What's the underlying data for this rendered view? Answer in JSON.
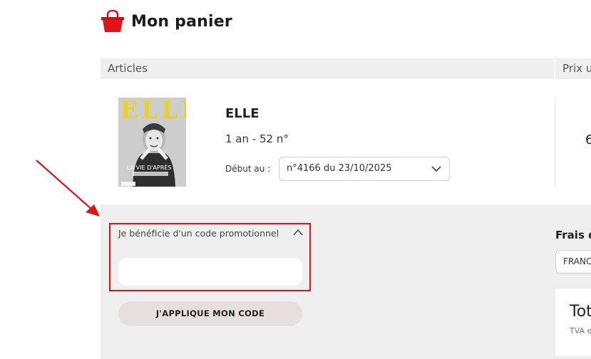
{
  "header": {
    "title": "Mon panier",
    "icon": "shopping-bag-icon"
  },
  "table": {
    "col_articles": "Articles",
    "col_price": "Prix u"
  },
  "product": {
    "cover_masthead": "ELLE",
    "cover_headline": "LA VIE D'APRÈS",
    "name": "ELLE",
    "duration": "1 an - 52 n°",
    "start_label": "Début au :",
    "start_value": "n°4166 du 23/10/2025",
    "price_partial": "6"
  },
  "promo": {
    "toggle_label": "Je bénéficie d'un code promotionnel",
    "input_value": "",
    "apply_label": "J'APPLIQUE MON CODE"
  },
  "shipping": {
    "label": "Frais d",
    "country": "FRANC"
  },
  "total": {
    "label": "Tot",
    "vat": "TVA e"
  },
  "colors": {
    "accent_red": "#e0131b",
    "panel_gray": "#efefef",
    "button_bg": "#e5dfdf"
  }
}
